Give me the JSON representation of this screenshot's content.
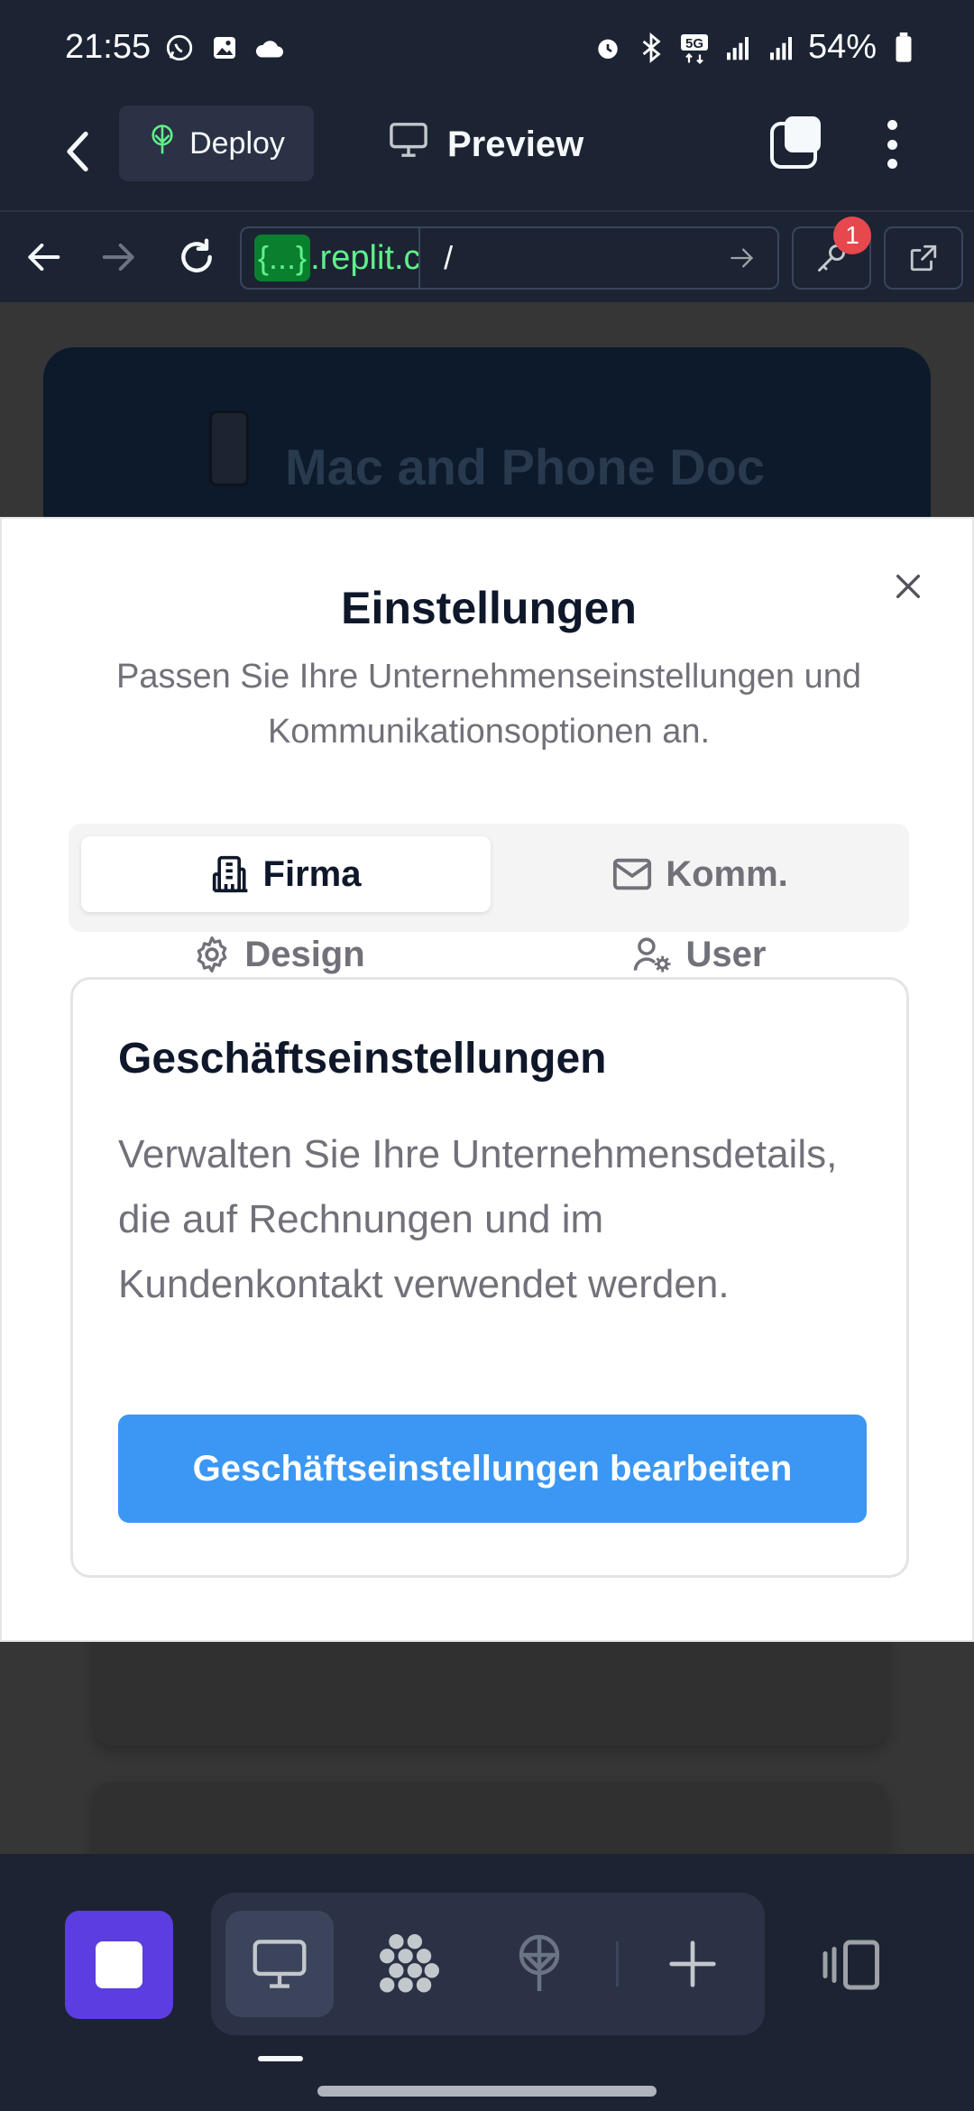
{
  "status_bar": {
    "time": "21:55",
    "battery": "54%",
    "left_icons": [
      "whatsapp-icon",
      "gallery-icon",
      "cloud-icon"
    ],
    "right_icons": [
      "alarm-icon",
      "bluetooth-icon",
      "5g-icon",
      "signal-icon",
      "signal-icon",
      "battery-icon"
    ]
  },
  "header": {
    "deploy_label": "Deploy",
    "preview_label": "Preview"
  },
  "browser": {
    "url_chip": "{...}",
    "url_host": ".replit.c",
    "url_path": "/",
    "secrets_badge": "1"
  },
  "background_page": {
    "hero_title": "Mac and Phone Doc"
  },
  "dialog": {
    "title": "Einstellungen",
    "description": "Passen Sie Ihre Unternehmenseinstellungen und Kommunikationsoptionen an.",
    "tabs": [
      {
        "label": "Firma",
        "icon": "building-icon",
        "active": true
      },
      {
        "label": "Komm.",
        "icon": "mail-icon",
        "active": false
      },
      {
        "label": "Design",
        "icon": "gear-icon",
        "active": false
      },
      {
        "label": "User",
        "icon": "user-settings-icon",
        "active": false
      }
    ],
    "card": {
      "title": "Geschäftseinstellungen",
      "description": "Verwalten Sie Ihre Unternehmensdetails, die auf Rechnungen und im Kundenkontakt verwendet werden.",
      "button_label": "Geschäftseinstellungen bearbeiten"
    }
  },
  "colors": {
    "replit_bg": "#1c2333",
    "accent_blue": "#3b97f3",
    "stop_purple": "#5b3de0",
    "url_green": "#5ff08a"
  }
}
